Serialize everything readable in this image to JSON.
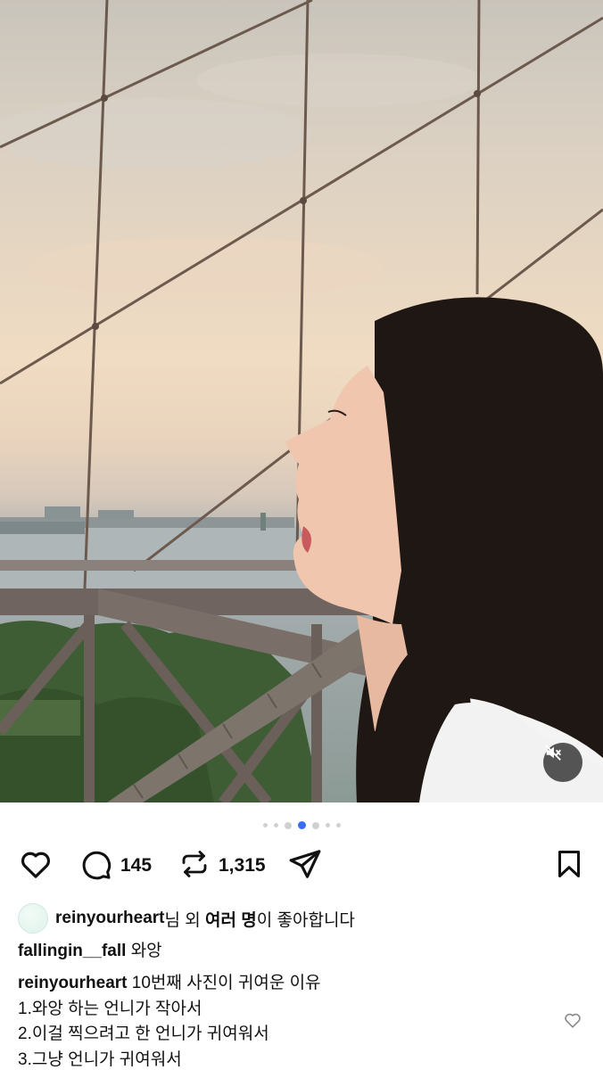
{
  "post": {
    "media_count": 7,
    "active_index": 3,
    "muted": true
  },
  "icons": {
    "mute": "speaker-muted-icon",
    "like": "heart-outline-icon",
    "comment": "comment-bubble-icon",
    "repost": "repost-arrows-icon",
    "share": "paper-plane-icon",
    "save": "bookmark-outline-icon",
    "comment_like": "small-heart-icon"
  },
  "actions": {
    "comments_count": "145",
    "reposts_count": "1,315"
  },
  "likes": {
    "user": "reinyourheart",
    "suffix_1": "님 외 ",
    "others": "여러 명",
    "suffix_2": "이 좋아합니다"
  },
  "top_comment": {
    "user": "fallingin__fall",
    "text": "와앙"
  },
  "caption": {
    "user": "reinyourheart",
    "first_line": "10번째 사진이 귀여운 이유",
    "lines": [
      "1.와앙 하는 언니가 작아서",
      "2.이걸 찍으려고 한 언니가 귀여워서",
      "3.그냥 언니가 귀여워서"
    ]
  },
  "colors": {
    "active_dot": "#3b6cf6",
    "inactive_dot": "#d0d0d0",
    "text": "#111111"
  }
}
